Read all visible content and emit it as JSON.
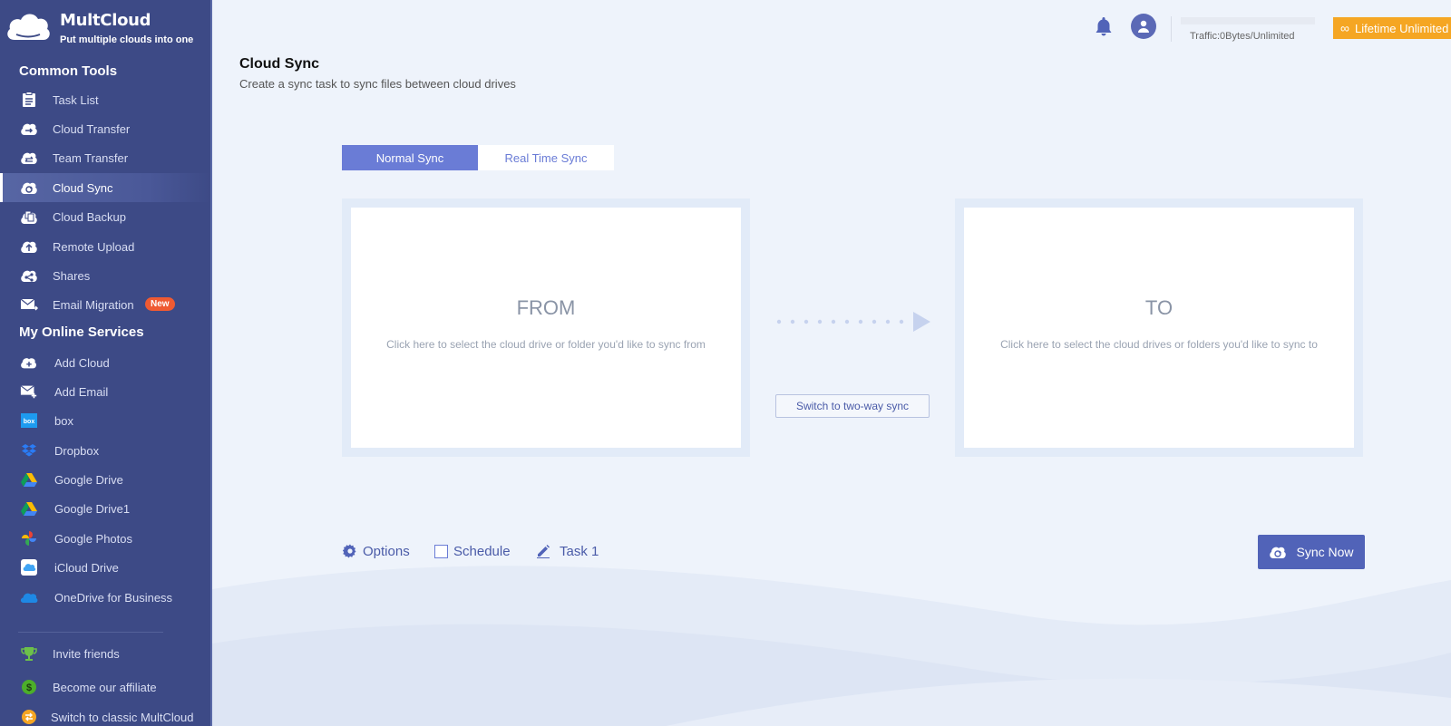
{
  "brand": {
    "name": "MultCloud",
    "tagline": "Put multiple clouds into one"
  },
  "sidebar": {
    "common_tools_title": "Common Tools",
    "common_tools": [
      {
        "label": "Task List",
        "icon": "task-list-icon"
      },
      {
        "label": "Cloud Transfer",
        "icon": "cloud-transfer-icon"
      },
      {
        "label": "Team Transfer",
        "icon": "team-transfer-icon"
      },
      {
        "label": "Cloud Sync",
        "icon": "cloud-sync-icon",
        "active": true
      },
      {
        "label": "Cloud Backup",
        "icon": "cloud-backup-icon"
      },
      {
        "label": "Remote Upload",
        "icon": "remote-upload-icon"
      },
      {
        "label": "Shares",
        "icon": "shares-icon"
      },
      {
        "label": "Email Migration",
        "icon": "email-migration-icon",
        "badge": "New"
      }
    ],
    "services_title": "My Online Services",
    "services": [
      {
        "label": "Add Cloud",
        "icon": "add-cloud-icon"
      },
      {
        "label": "Add Email",
        "icon": "add-email-icon"
      },
      {
        "label": "box",
        "icon": "box-icon"
      },
      {
        "label": "Dropbox",
        "icon": "dropbox-icon"
      },
      {
        "label": "Google Drive",
        "icon": "google-drive-icon"
      },
      {
        "label": "Google Drive1",
        "icon": "google-drive-icon"
      },
      {
        "label": "Google Photos",
        "icon": "google-photos-icon"
      },
      {
        "label": "iCloud Drive",
        "icon": "icloud-drive-icon"
      },
      {
        "label": "OneDrive for Business",
        "icon": "onedrive-icon"
      }
    ],
    "footer": [
      {
        "label": "Invite friends",
        "icon": "trophy-icon"
      },
      {
        "label": "Become our affiliate",
        "icon": "dollar-icon"
      },
      {
        "label": "Switch to classic MultCloud",
        "icon": "switch-icon"
      }
    ]
  },
  "header": {
    "traffic": "Traffic:0Bytes/Unlimited",
    "lifetime_label": "Lifetime Unlimited"
  },
  "page": {
    "title": "Cloud Sync",
    "subtitle": "Create a sync task to sync files between cloud drives"
  },
  "tabs": {
    "normal": "Normal Sync",
    "realtime": "Real Time Sync"
  },
  "from_box": {
    "title": "FROM",
    "hint": "Click here to select the cloud drive or folder you'd like to sync from"
  },
  "to_box": {
    "title": "TO",
    "hint": "Click here to select the cloud drives or folders you'd like to sync to"
  },
  "switch_two_way": "Switch to two-way sync",
  "options": {
    "options_label": "Options",
    "schedule_label": "Schedule",
    "task_name": "Task 1"
  },
  "sync_now": "Sync Now",
  "colors": {
    "sidebar_bg": "#3d4a86",
    "accent": "#6a7cd6",
    "primary_button": "#5163b8",
    "lifetime_button": "#f5a623",
    "new_badge": "#ef5a32"
  }
}
